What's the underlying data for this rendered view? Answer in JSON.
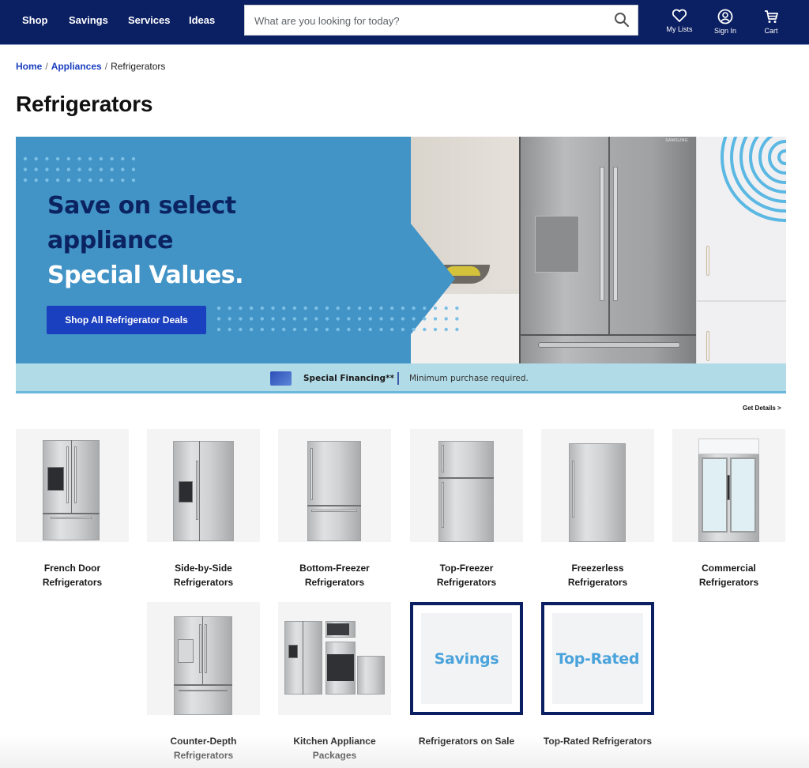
{
  "header": {
    "nav": [
      "Shop",
      "Savings",
      "Services",
      "Ideas"
    ],
    "search": {
      "placeholder": "What are you looking for today?",
      "value": ""
    },
    "utilities": [
      {
        "label": "My Lists",
        "icon": "heart-icon"
      },
      {
        "label": "Sign In",
        "icon": "user-circle-icon"
      },
      {
        "label": "Cart",
        "icon": "cart-icon"
      }
    ],
    "colors": {
      "bar": "#0b1f63"
    }
  },
  "breadcrumb": {
    "items": [
      {
        "label": "Home",
        "link": true
      },
      {
        "label": "Appliances",
        "link": true
      },
      {
        "label": "Refrigerators",
        "link": false
      }
    ],
    "separator": "/"
  },
  "page_title": "Refrigerators",
  "banner": {
    "headline_line1": "Save on select",
    "headline_line2": "appliance",
    "headline_line3": "Special Values.",
    "cta_label": "Shop All Refrigerator Deals",
    "brand_mark": "SAMSUNG",
    "financing_title": "Special Financing**",
    "financing_note": "Minimum purchase required.",
    "details_link": "Get Details >",
    "colors": {
      "banner_bg": "#4293c6",
      "cta_bg": "#1a3fbf",
      "financing_bg": "#b1dbe7"
    }
  },
  "categories": [
    {
      "label": "French Door Refrigerators",
      "line1": "French Door",
      "line2": "Refrigerators",
      "type": "french-door"
    },
    {
      "label": "Side-by-Side Refrigerators",
      "line1": "Side-by-Side",
      "line2": "Refrigerators",
      "type": "side-by-side"
    },
    {
      "label": "Bottom-Freezer Refrigerators",
      "line1": "Bottom-Freezer",
      "line2": "Refrigerators",
      "type": "bottom-freezer"
    },
    {
      "label": "Top-Freezer Refrigerators",
      "line1": "Top-Freezer",
      "line2": "Refrigerators",
      "type": "top-freezer"
    },
    {
      "label": "Freezerless Refrigerators",
      "line1": "Freezerless Refrigerators",
      "line2": "",
      "type": "freezerless"
    },
    {
      "label": "Commercial Refrigerators",
      "line1": "Commercial",
      "line2": "Refrigerators",
      "type": "commercial"
    },
    {
      "label": "Counter-Depth Refrigerators",
      "line1": "Counter-Depth",
      "line2": "Refrigerators",
      "type": "counter-depth"
    },
    {
      "label": "Kitchen Appliance Packages",
      "line1": "Kitchen Appliance",
      "line2": "Packages",
      "type": "packages"
    },
    {
      "label": "Refrigerators on Sale",
      "line1": "Refrigerators on Sale",
      "line2": "",
      "type": "promo",
      "promo_word": "Savings"
    },
    {
      "label": "Top-Rated Refrigerators",
      "line1": "Top-Rated Refrigerators",
      "line2": "",
      "type": "promo",
      "promo_word": "Top-Rated"
    }
  ]
}
